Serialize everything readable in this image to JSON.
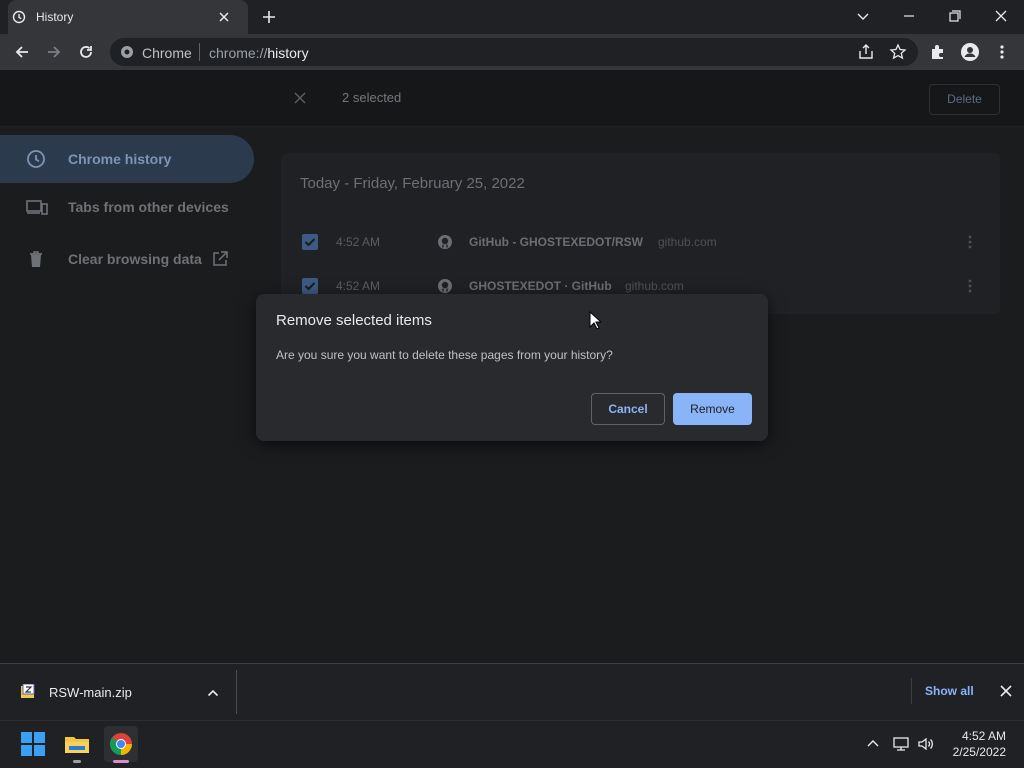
{
  "tab": {
    "title": "History"
  },
  "omnibox": {
    "site": "Chrome",
    "url_scheme": "chrome://",
    "url_host": "history"
  },
  "selection": {
    "count_label": "2 selected",
    "delete_label": "Delete"
  },
  "sidebar": {
    "items": [
      {
        "label": "Chrome history",
        "icon": "clock-icon",
        "active": true
      },
      {
        "label": "Tabs from other devices",
        "icon": "devices-icon",
        "active": false
      },
      {
        "label": "Clear browsing data",
        "icon": "trash-icon",
        "active": false
      }
    ]
  },
  "history": {
    "day_title": "Today - Friday, February 25, 2022",
    "entries": [
      {
        "time": "4:52 AM",
        "title": "GitHub - GHOSTEXEDOT/RSW",
        "domain": "github.com",
        "checked": true
      },
      {
        "time": "4:52 AM",
        "title": "GHOSTEXEDOT · GitHub",
        "domain": "github.com",
        "checked": true
      }
    ]
  },
  "dialog": {
    "title": "Remove selected items",
    "body": "Are you sure you want to delete these pages from your history?",
    "cancel_label": "Cancel",
    "remove_label": "Remove"
  },
  "download_shelf": {
    "file_name": "RSW-main.zip",
    "show_all_label": "Show all"
  },
  "taskbar": {
    "time": "4:52 AM",
    "date": "2/25/2022"
  },
  "colors": {
    "accent": "#8ab4f8",
    "background": "#202124",
    "dialog": "#292a2d"
  }
}
